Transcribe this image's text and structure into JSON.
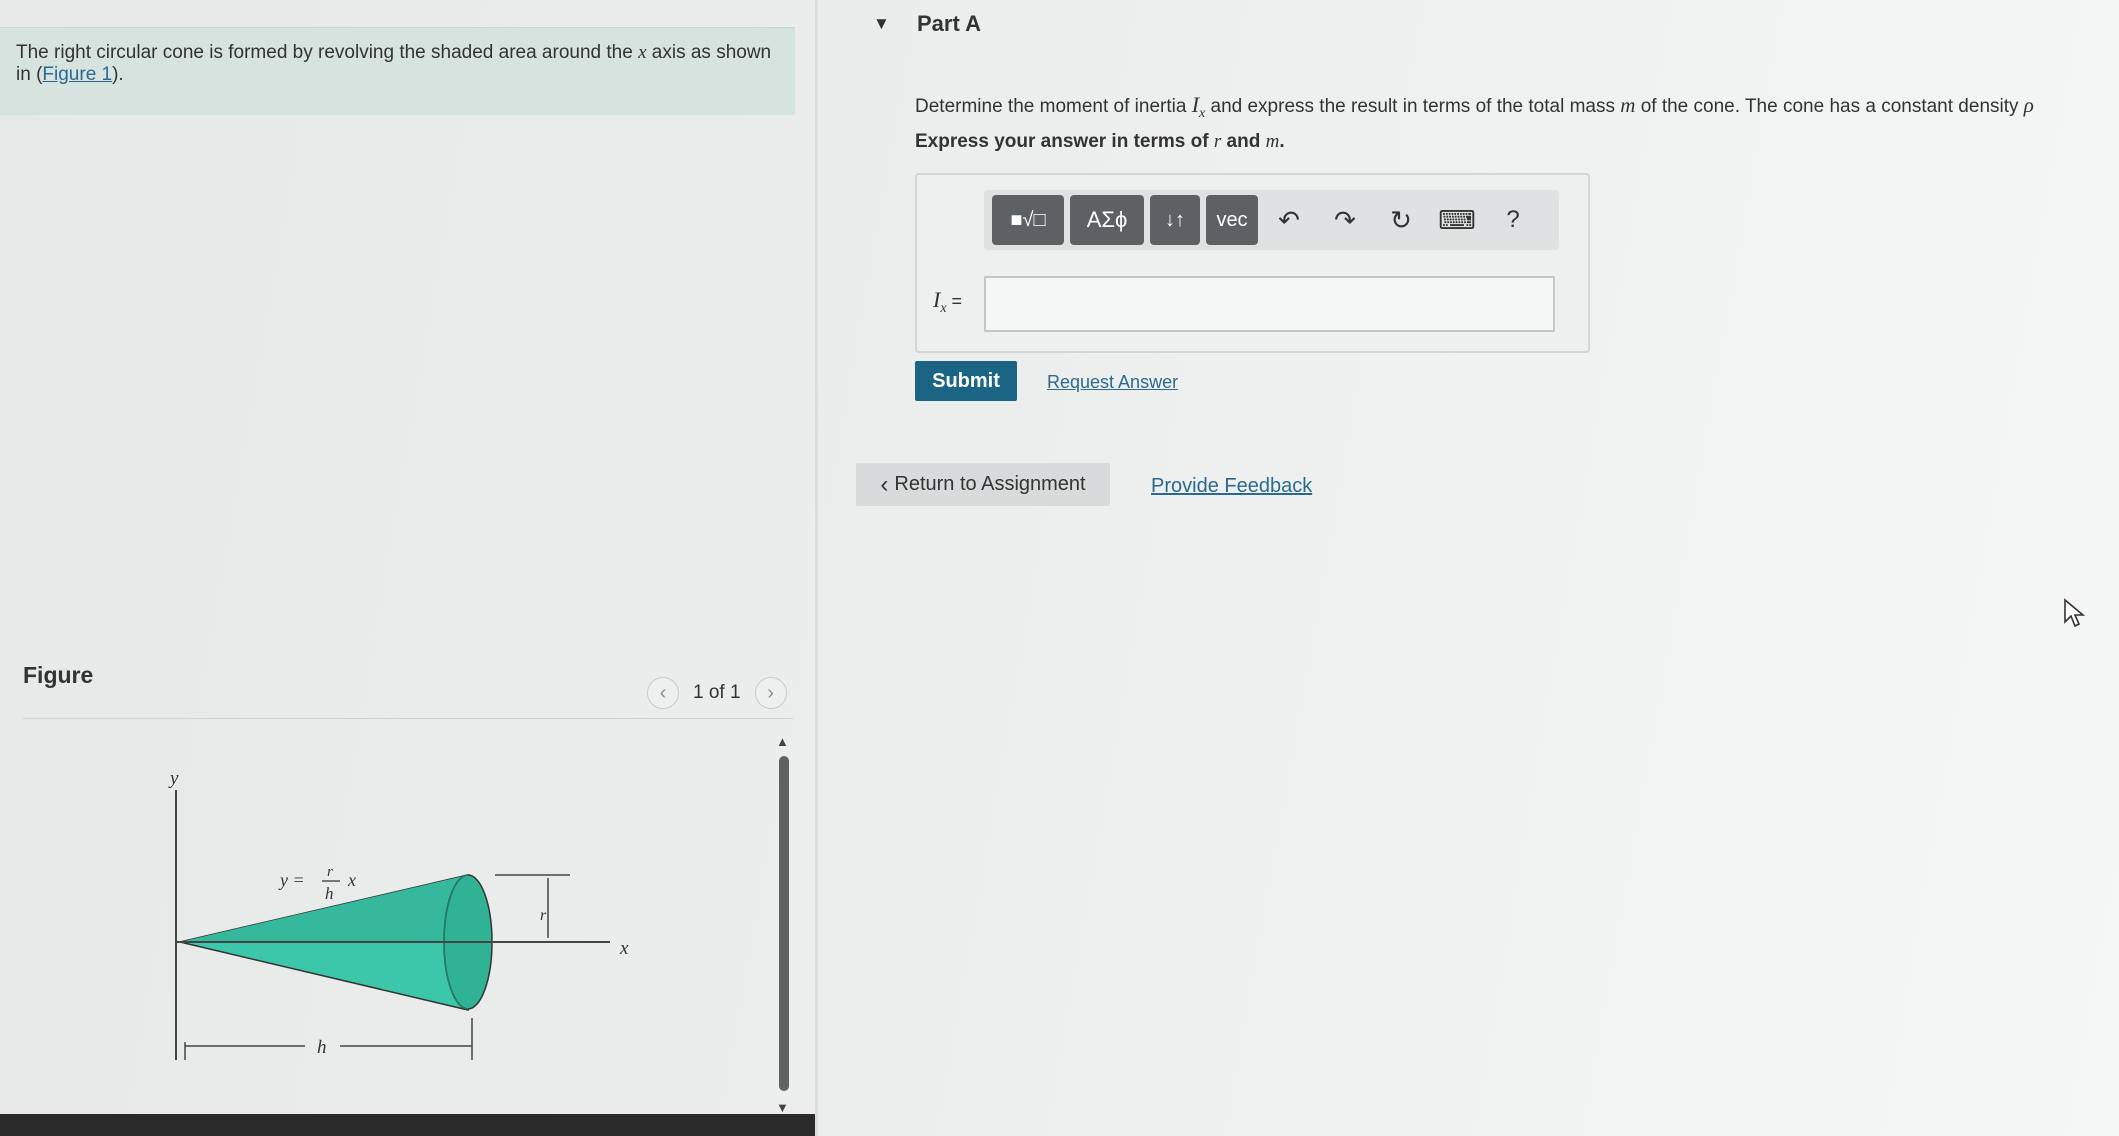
{
  "intro": {
    "text_before": "The right circular cone is formed by revolving the shaded area around the ",
    "axis_var": "x",
    "text_after": " axis as shown in (",
    "figure_link": "Figure 1",
    "text_end": ")."
  },
  "figure": {
    "heading": "Figure",
    "pager": "1 of 1",
    "labels": {
      "y_axis": "y",
      "x_axis": "x",
      "equation_lhs": "y =",
      "frac_num": "r",
      "frac_den": "h",
      "equation_x": "x",
      "r": "r",
      "h": "h"
    },
    "fill_color": "#3cc7aa"
  },
  "part": {
    "title": "Part A",
    "question_prefix": "Determine the moment of inertia ",
    "inertia_symbol": "I",
    "inertia_sub": "x",
    "question_mid": " and express the result in terms of the total mass ",
    "mass_symbol": "m",
    "question_suffix": " of the cone. The cone has a constant density ",
    "density_symbol": "ρ",
    "instruction_prefix": "Express your answer in terms of ",
    "instr_r": "r",
    "instr_and": " and ",
    "instr_m": "m",
    "instr_end": "."
  },
  "toolbar": {
    "template_icon": "■√□",
    "greek_label": "ΑΣϕ",
    "arrows_label": "↓↑",
    "vec_label": "vec",
    "undo_icon": "↶",
    "redo_icon": "↷",
    "reset_icon": "↻",
    "keyboard_icon": "⌨",
    "help_label": "?"
  },
  "answer": {
    "label_symbol": "I",
    "label_sub": "x",
    "label_eq": " =",
    "value": ""
  },
  "actions": {
    "submit_label": "Submit",
    "request_answer_label": "Request Answer",
    "return_label": "Return to Assignment",
    "feedback_label": "Provide Feedback"
  },
  "colors": {
    "submit_bg": "#1b6484",
    "link": "#2a6a8f",
    "intro_bg": "#d6e3df",
    "cone_fill": "#3cc7aa"
  }
}
